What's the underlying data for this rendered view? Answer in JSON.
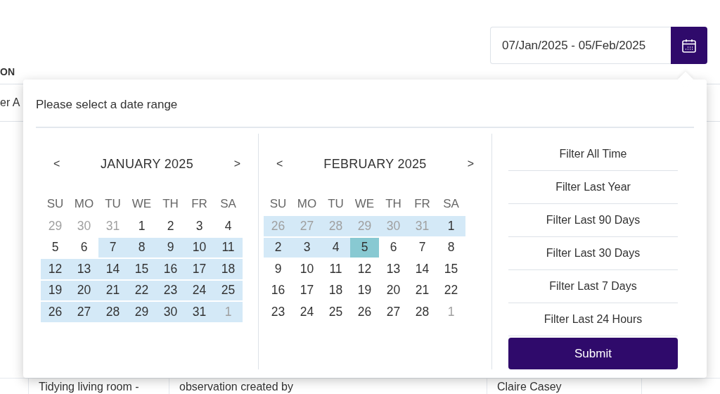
{
  "date_field": {
    "value": "07/Jan/2025 - 05/Feb/2025"
  },
  "background_table": {
    "column_header": "ON",
    "filter_value": "er A",
    "row": [
      "Tidying living room -",
      "observation created by",
      "Claire Casey"
    ]
  },
  "popup": {
    "prompt": "Please select a date range",
    "months": [
      {
        "title": "JANUARY 2025",
        "prev": "<",
        "next": ">",
        "weekdays": [
          "SU",
          "MO",
          "TU",
          "WE",
          "TH",
          "FR",
          "SA"
        ],
        "weeks": [
          [
            {
              "day": "29",
              "outside": true,
              "in_range": false,
              "selected": false
            },
            {
              "day": "30",
              "outside": true,
              "in_range": false,
              "selected": false
            },
            {
              "day": "31",
              "outside": true,
              "in_range": false,
              "selected": false
            },
            {
              "day": "1",
              "outside": false,
              "in_range": false,
              "selected": false
            },
            {
              "day": "2",
              "outside": false,
              "in_range": false,
              "selected": false
            },
            {
              "day": "3",
              "outside": false,
              "in_range": false,
              "selected": false
            },
            {
              "day": "4",
              "outside": false,
              "in_range": false,
              "selected": false
            }
          ],
          [
            {
              "day": "5",
              "outside": false,
              "in_range": false,
              "selected": false
            },
            {
              "day": "6",
              "outside": false,
              "in_range": false,
              "selected": false
            },
            {
              "day": "7",
              "outside": false,
              "in_range": true,
              "selected": false
            },
            {
              "day": "8",
              "outside": false,
              "in_range": true,
              "selected": false
            },
            {
              "day": "9",
              "outside": false,
              "in_range": true,
              "selected": false
            },
            {
              "day": "10",
              "outside": false,
              "in_range": true,
              "selected": false
            },
            {
              "day": "11",
              "outside": false,
              "in_range": true,
              "selected": false
            }
          ],
          [
            {
              "day": "12",
              "outside": false,
              "in_range": true,
              "selected": false
            },
            {
              "day": "13",
              "outside": false,
              "in_range": true,
              "selected": false
            },
            {
              "day": "14",
              "outside": false,
              "in_range": true,
              "selected": false
            },
            {
              "day": "15",
              "outside": false,
              "in_range": true,
              "selected": false
            },
            {
              "day": "16",
              "outside": false,
              "in_range": true,
              "selected": false
            },
            {
              "day": "17",
              "outside": false,
              "in_range": true,
              "selected": false
            },
            {
              "day": "18",
              "outside": false,
              "in_range": true,
              "selected": false
            }
          ],
          [
            {
              "day": "19",
              "outside": false,
              "in_range": true,
              "selected": false
            },
            {
              "day": "20",
              "outside": false,
              "in_range": true,
              "selected": false
            },
            {
              "day": "21",
              "outside": false,
              "in_range": true,
              "selected": false
            },
            {
              "day": "22",
              "outside": false,
              "in_range": true,
              "selected": false
            },
            {
              "day": "23",
              "outside": false,
              "in_range": true,
              "selected": false
            },
            {
              "day": "24",
              "outside": false,
              "in_range": true,
              "selected": false
            },
            {
              "day": "25",
              "outside": false,
              "in_range": true,
              "selected": false
            }
          ],
          [
            {
              "day": "26",
              "outside": false,
              "in_range": true,
              "selected": false
            },
            {
              "day": "27",
              "outside": false,
              "in_range": true,
              "selected": false
            },
            {
              "day": "28",
              "outside": false,
              "in_range": true,
              "selected": false
            },
            {
              "day": "29",
              "outside": false,
              "in_range": true,
              "selected": false
            },
            {
              "day": "30",
              "outside": false,
              "in_range": true,
              "selected": false
            },
            {
              "day": "31",
              "outside": false,
              "in_range": true,
              "selected": false
            },
            {
              "day": "1",
              "outside": true,
              "in_range": true,
              "selected": false
            }
          ]
        ]
      },
      {
        "title": "FEBRUARY 2025",
        "prev": "<",
        "next": ">",
        "weekdays": [
          "SU",
          "MO",
          "TU",
          "WE",
          "TH",
          "FR",
          "SA"
        ],
        "weeks": [
          [
            {
              "day": "26",
              "outside": true,
              "in_range": true,
              "selected": false
            },
            {
              "day": "27",
              "outside": true,
              "in_range": true,
              "selected": false
            },
            {
              "day": "28",
              "outside": true,
              "in_range": true,
              "selected": false
            },
            {
              "day": "29",
              "outside": true,
              "in_range": true,
              "selected": false
            },
            {
              "day": "30",
              "outside": true,
              "in_range": true,
              "selected": false
            },
            {
              "day": "31",
              "outside": true,
              "in_range": true,
              "selected": false
            },
            {
              "day": "1",
              "outside": false,
              "in_range": true,
              "selected": false
            }
          ],
          [
            {
              "day": "2",
              "outside": false,
              "in_range": true,
              "selected": false
            },
            {
              "day": "3",
              "outside": false,
              "in_range": true,
              "selected": false
            },
            {
              "day": "4",
              "outside": false,
              "in_range": true,
              "selected": false
            },
            {
              "day": "5",
              "outside": false,
              "in_range": true,
              "selected": true
            },
            {
              "day": "6",
              "outside": false,
              "in_range": false,
              "selected": false
            },
            {
              "day": "7",
              "outside": false,
              "in_range": false,
              "selected": false
            },
            {
              "day": "8",
              "outside": false,
              "in_range": false,
              "selected": false
            }
          ],
          [
            {
              "day": "9",
              "outside": false,
              "in_range": false,
              "selected": false
            },
            {
              "day": "10",
              "outside": false,
              "in_range": false,
              "selected": false
            },
            {
              "day": "11",
              "outside": false,
              "in_range": false,
              "selected": false
            },
            {
              "day": "12",
              "outside": false,
              "in_range": false,
              "selected": false
            },
            {
              "day": "13",
              "outside": false,
              "in_range": false,
              "selected": false
            },
            {
              "day": "14",
              "outside": false,
              "in_range": false,
              "selected": false
            },
            {
              "day": "15",
              "outside": false,
              "in_range": false,
              "selected": false
            }
          ],
          [
            {
              "day": "16",
              "outside": false,
              "in_range": false,
              "selected": false
            },
            {
              "day": "17",
              "outside": false,
              "in_range": false,
              "selected": false
            },
            {
              "day": "18",
              "outside": false,
              "in_range": false,
              "selected": false
            },
            {
              "day": "19",
              "outside": false,
              "in_range": false,
              "selected": false
            },
            {
              "day": "20",
              "outside": false,
              "in_range": false,
              "selected": false
            },
            {
              "day": "21",
              "outside": false,
              "in_range": false,
              "selected": false
            },
            {
              "day": "22",
              "outside": false,
              "in_range": false,
              "selected": false
            }
          ],
          [
            {
              "day": "23",
              "outside": false,
              "in_range": false,
              "selected": false
            },
            {
              "day": "24",
              "outside": false,
              "in_range": false,
              "selected": false
            },
            {
              "day": "25",
              "outside": false,
              "in_range": false,
              "selected": false
            },
            {
              "day": "26",
              "outside": false,
              "in_range": false,
              "selected": false
            },
            {
              "day": "27",
              "outside": false,
              "in_range": false,
              "selected": false
            },
            {
              "day": "28",
              "outside": false,
              "in_range": false,
              "selected": false
            },
            {
              "day": "1",
              "outside": true,
              "in_range": false,
              "selected": false
            }
          ]
        ]
      }
    ],
    "filters": [
      "Filter All Time",
      "Filter Last Year",
      "Filter Last 90 Days",
      "Filter Last 30 Days",
      "Filter Last 7 Days",
      "Filter Last 24 Hours"
    ],
    "submit": "Submit"
  }
}
